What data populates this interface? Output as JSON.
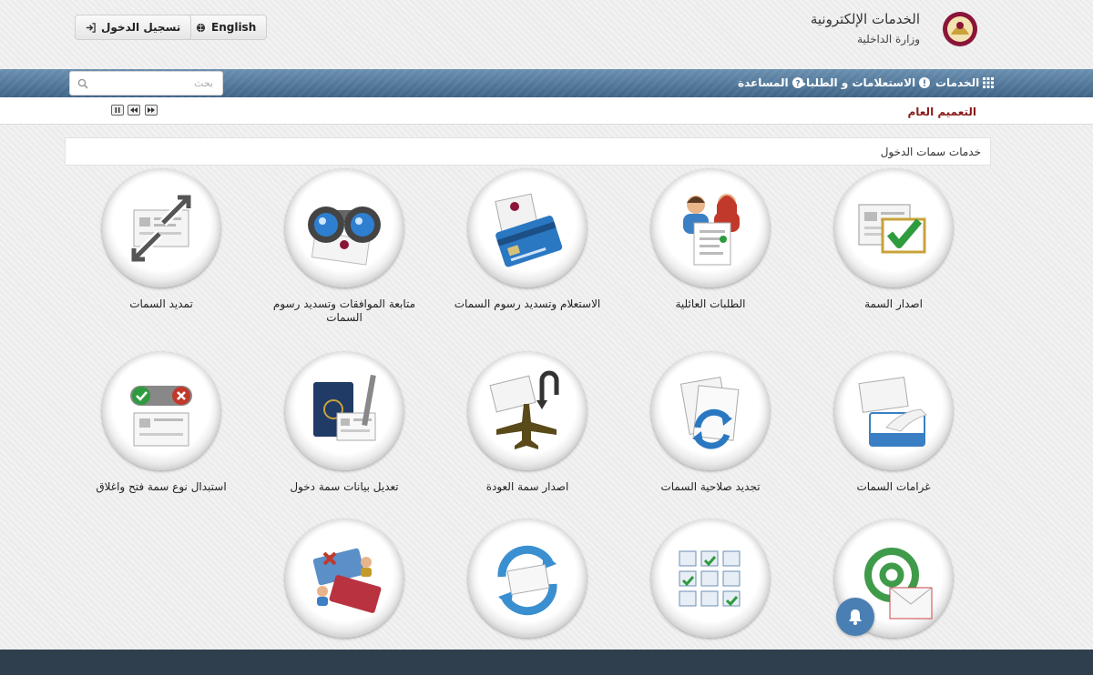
{
  "header": {
    "title": "الخدمات الإلكترونية",
    "subtitle": "وزارة الداخلية",
    "login_label": "تسجيل الدخول",
    "language_label": "English",
    "logo_icon": "qatar-emblem-icon"
  },
  "nav": {
    "services_label": "الخدمات",
    "inquiries_label": "الاستعلامات و الطلبات",
    "help_label": "المساعدة"
  },
  "search": {
    "placeholder": "بحث"
  },
  "ticker": {
    "label": "التعميم العام"
  },
  "section": {
    "title": "خدمات سمات الدخول"
  },
  "tiles": [
    {
      "label": "اصدار السمة",
      "icon": "visa-checkbox-icon"
    },
    {
      "label": "الطلبات العائلية",
      "icon": "family-document-icon"
    },
    {
      "label": "الاستعلام وتسديد رسوم السمات",
      "icon": "credit-card-icon"
    },
    {
      "label": "متابعة الموافقات وتسديد رسوم السمات",
      "icon": "binoculars-icon"
    },
    {
      "label": "تمديد السمات",
      "icon": "extend-arrows-icon"
    },
    {
      "label": "غرامات السمات",
      "icon": "hand-card-icon"
    },
    {
      "label": "تجديد صلاحية السمات",
      "icon": "renew-documents-icon"
    },
    {
      "label": "اصدار سمة العودة",
      "icon": "airplane-return-icon"
    },
    {
      "label": "تعديل بيانات سمة دخول",
      "icon": "passport-pen-icon"
    },
    {
      "label": "استبدال نوع سمة فتح واغلاق",
      "icon": "toggle-check-cross-icon"
    },
    {
      "label": "",
      "icon": "email-at-icon"
    },
    {
      "label": "",
      "icon": "document-grid-icon"
    },
    {
      "label": "",
      "icon": "cycle-cards-icon"
    },
    {
      "label": "",
      "icon": "passport-transfer-icon"
    }
  ],
  "colors": {
    "navbar": "#4d7295",
    "ticker_label": "#8b1a1a",
    "footer": "#2f3f4e",
    "bell": "#4a7fb3"
  }
}
